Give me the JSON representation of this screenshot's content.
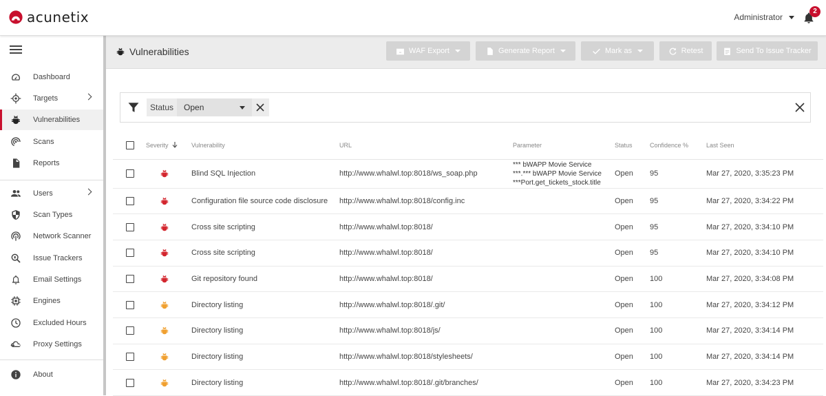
{
  "app": {
    "name": "acunetix"
  },
  "user": {
    "name": "Administrator",
    "notifications": "2"
  },
  "sidebar": {
    "items": [
      {
        "label": "Dashboard",
        "icon": "dashboard-icon"
      },
      {
        "label": "Targets",
        "icon": "target-icon",
        "has_submenu": true
      },
      {
        "label": "Vulnerabilities",
        "icon": "bug-icon",
        "active": true
      },
      {
        "label": "Scans",
        "icon": "scan-icon"
      },
      {
        "label": "Reports",
        "icon": "report-icon"
      },
      {
        "label": "Users",
        "icon": "users-icon",
        "has_submenu": true
      },
      {
        "label": "Scan Types",
        "icon": "shield-icon"
      },
      {
        "label": "Network Scanner",
        "icon": "network-icon"
      },
      {
        "label": "Issue Trackers",
        "icon": "issue-tracker-icon"
      },
      {
        "label": "Email Settings",
        "icon": "bell-icon"
      },
      {
        "label": "Engines",
        "icon": "chip-icon"
      },
      {
        "label": "Excluded Hours",
        "icon": "clock-icon"
      },
      {
        "label": "Proxy Settings",
        "icon": "cloud-icon"
      },
      {
        "label": "About",
        "icon": "info-icon"
      }
    ]
  },
  "header": {
    "title": "Vulnerabilities",
    "buttons": {
      "waf_export": "WAF Export",
      "generate_report": "Generate Report",
      "mark_as": "Mark as",
      "retest": "Retest",
      "send_to_tracker": "Send To Issue Tracker"
    }
  },
  "filter": {
    "label": "Status",
    "value": "Open"
  },
  "table": {
    "columns": {
      "severity": "Severity",
      "vulnerability": "Vulnerability",
      "url": "URL",
      "parameter": "Parameter",
      "status": "Status",
      "confidence": "Confidence %",
      "last_seen": "Last Seen"
    },
    "rows": [
      {
        "severity": "high",
        "vulnerability": "Blind SQL Injection",
        "url": "http://www.whalwl.top:8018/ws_soap.php",
        "parameter": [
          "*** bWAPP Movie Service",
          "***.*** bWAPP Movie Service",
          "***Port.get_tickets_stock.title"
        ],
        "status": "Open",
        "confidence": "95",
        "last_seen": "Mar 27, 2020, 3:35:23 PM"
      },
      {
        "severity": "high",
        "vulnerability": "Configuration file source code disclosure",
        "url": "http://www.whalwl.top:8018/config.inc",
        "parameter": [],
        "status": "Open",
        "confidence": "95",
        "last_seen": "Mar 27, 2020, 3:34:22 PM"
      },
      {
        "severity": "high",
        "vulnerability": "Cross site scripting",
        "url": "http://www.whalwl.top:8018/",
        "parameter": [],
        "status": "Open",
        "confidence": "95",
        "last_seen": "Mar 27, 2020, 3:34:10 PM"
      },
      {
        "severity": "high",
        "vulnerability": "Cross site scripting",
        "url": "http://www.whalwl.top:8018/",
        "parameter": [],
        "status": "Open",
        "confidence": "95",
        "last_seen": "Mar 27, 2020, 3:34:10 PM"
      },
      {
        "severity": "high",
        "vulnerability": "Git repository found",
        "url": "http://www.whalwl.top:8018/",
        "parameter": [],
        "status": "Open",
        "confidence": "100",
        "last_seen": "Mar 27, 2020, 3:34:08 PM"
      },
      {
        "severity": "medium",
        "vulnerability": "Directory listing",
        "url": "http://www.whalwl.top:8018/.git/",
        "parameter": [],
        "status": "Open",
        "confidence": "100",
        "last_seen": "Mar 27, 2020, 3:34:12 PM"
      },
      {
        "severity": "medium",
        "vulnerability": "Directory listing",
        "url": "http://www.whalwl.top:8018/js/",
        "parameter": [],
        "status": "Open",
        "confidence": "100",
        "last_seen": "Mar 27, 2020, 3:34:14 PM"
      },
      {
        "severity": "medium",
        "vulnerability": "Directory listing",
        "url": "http://www.whalwl.top:8018/stylesheets/",
        "parameter": [],
        "status": "Open",
        "confidence": "100",
        "last_seen": "Mar 27, 2020, 3:34:14 PM"
      },
      {
        "severity": "medium",
        "vulnerability": "Directory listing",
        "url": "http://www.whalwl.top:8018/.git/branches/",
        "parameter": [],
        "status": "Open",
        "confidence": "100",
        "last_seen": "Mar 27, 2020, 3:34:23 PM"
      }
    ]
  },
  "colors": {
    "brand": "#c8102e",
    "severity_high": "#d3262e",
    "severity_medium": "#f0a030",
    "button_disabled": "#d4d4d4"
  }
}
